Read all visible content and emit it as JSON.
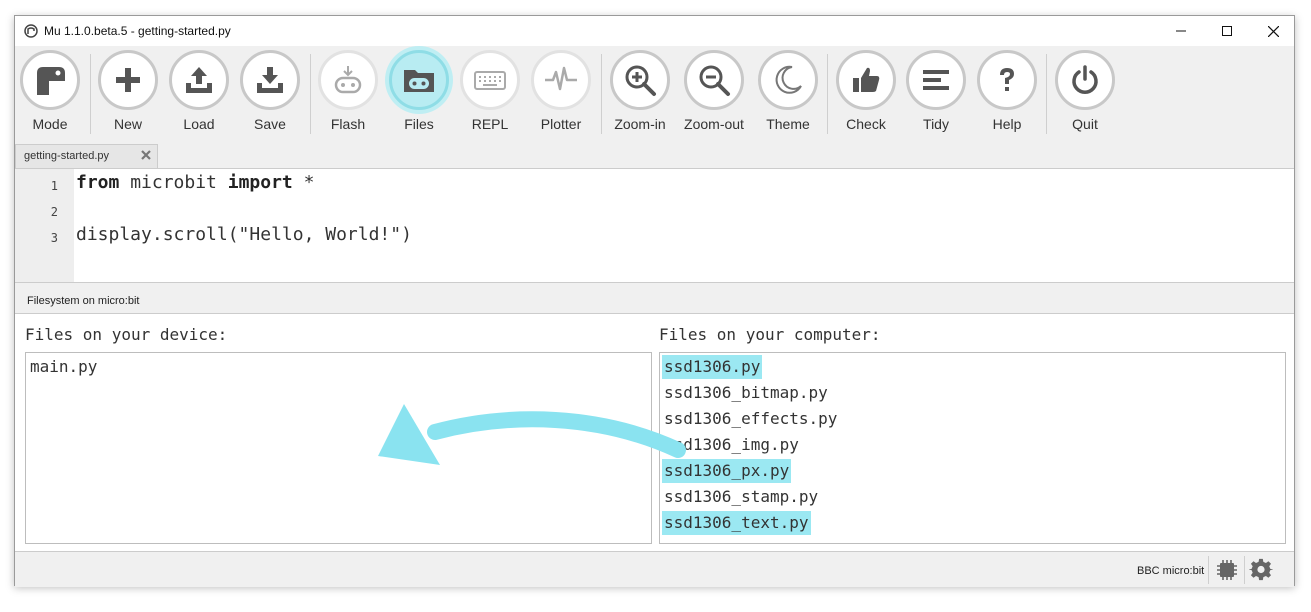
{
  "window": {
    "title": "Mu 1.1.0.beta.5 - getting-started.py"
  },
  "toolbar": {
    "buttons": [
      {
        "label": "Mode",
        "icon": "mode-icon",
        "state": "enabled"
      },
      {
        "label": "New",
        "icon": "plus-icon",
        "state": "enabled"
      },
      {
        "label": "Load",
        "icon": "upload-icon",
        "state": "enabled"
      },
      {
        "label": "Save",
        "icon": "download-icon",
        "state": "enabled"
      },
      {
        "label": "Flash",
        "icon": "flash-device-icon",
        "state": "disabled"
      },
      {
        "label": "Files",
        "icon": "files-device-icon",
        "state": "active"
      },
      {
        "label": "REPL",
        "icon": "keyboard-icon",
        "state": "disabled"
      },
      {
        "label": "Plotter",
        "icon": "pulse-icon",
        "state": "disabled"
      },
      {
        "label": "Zoom-in",
        "icon": "zoom-in-icon",
        "state": "enabled"
      },
      {
        "label": "Zoom-out",
        "icon": "zoom-out-icon",
        "state": "enabled"
      },
      {
        "label": "Theme",
        "icon": "moon-icon",
        "state": "enabled"
      },
      {
        "label": "Check",
        "icon": "thumbs-up-icon",
        "state": "enabled"
      },
      {
        "label": "Tidy",
        "icon": "tidy-lines-icon",
        "state": "enabled"
      },
      {
        "label": "Help",
        "icon": "question-icon",
        "state": "enabled"
      },
      {
        "label": "Quit",
        "icon": "power-icon",
        "state": "enabled"
      }
    ]
  },
  "tabs": [
    {
      "label": "getting-started.py"
    }
  ],
  "editor": {
    "line_numbers": [
      "1",
      "2",
      "3"
    ],
    "line1": {
      "kw1": "from",
      "mid": " microbit ",
      "kw2": "import",
      "rest": " *"
    },
    "line2": "",
    "line3": "display.scroll(\"Hello, World!\")"
  },
  "filesystem": {
    "title": "Filesystem on micro:bit",
    "device_heading": "Files on your device:",
    "computer_heading": "Files on your computer:",
    "device_files": [
      "main.py"
    ],
    "computer_files": [
      {
        "name": "ssd1306.py",
        "selected": true
      },
      {
        "name": "ssd1306_bitmap.py",
        "selected": false
      },
      {
        "name": "ssd1306_effects.py",
        "selected": false
      },
      {
        "name": "ssd1306_img.py",
        "selected": false
      },
      {
        "name": "ssd1306_px.py",
        "selected": true
      },
      {
        "name": "ssd1306_stamp.py",
        "selected": false
      },
      {
        "name": "ssd1306_text.py",
        "selected": true
      }
    ]
  },
  "statusbar": {
    "mode": "BBC micro:bit"
  },
  "colors": {
    "selection": "#9be8f2",
    "arrow": "#8ae3f0",
    "active_button": "#b8ecf2",
    "icon": "#555555"
  }
}
